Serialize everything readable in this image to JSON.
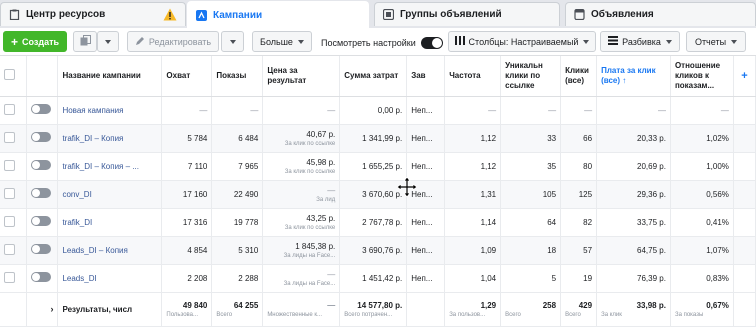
{
  "tabs": [
    {
      "label": "Центр ресурсов",
      "icon": "clipboard-icon"
    },
    {
      "label": "Кампании",
      "icon": "campaign-icon"
    },
    {
      "label": "Группы объявлений",
      "icon": "grid-icon"
    },
    {
      "label": "Объявления",
      "icon": "page-icon"
    }
  ],
  "toolbar": {
    "create_label": "Создать",
    "edit_label": "Редактировать",
    "more_label": "Больше",
    "view_settings_label": "Посмотреть настройки",
    "columns_label": "Столбцы: Настраиваемый",
    "breakdown_label": "Разбивка",
    "reports_label": "Отчеты"
  },
  "columns": {
    "name": "Название кампании",
    "reach": "Охват",
    "impressions": "Показы",
    "cost_per_result": "Цена за результат",
    "amount_spent": "Сумма затрат",
    "end": "Зав",
    "frequency": "Частота",
    "unique_link_clicks": "Уникальн клики по ссылке",
    "clicks_all": "Клики (все)",
    "cpc_all": "Плата за клик (все)",
    "ctr": "Отношение кликов к показам..."
  },
  "rows": [
    {
      "name": "Новая кампания",
      "reach": "—",
      "impressions": "—",
      "cpr": "—",
      "cpr_sub": "",
      "spent": "0,00 р.",
      "end": "Неп...",
      "freq": "—",
      "ulc": "—",
      "clicks": "—",
      "cpc": "—",
      "ctr": "—"
    },
    {
      "name": "trafik_DI – Копия",
      "reach": "5 784",
      "impressions": "6 484",
      "cpr": "40,67 р.",
      "cpr_sub": "За клик по ссылке",
      "spent": "1 341,99 р.",
      "end": "Неп...",
      "freq": "1,12",
      "ulc": "33",
      "clicks": "66",
      "cpc": "20,33 р.",
      "ctr": "1,02%"
    },
    {
      "name": "trafik_DI – Копия – ...",
      "reach": "7 110",
      "impressions": "7 965",
      "cpr": "45,98 р.",
      "cpr_sub": "За клик по ссылке",
      "spent": "1 655,25 р.",
      "end": "Неп...",
      "freq": "1,12",
      "ulc": "35",
      "clicks": "80",
      "cpc": "20,69 р.",
      "ctr": "1,00%"
    },
    {
      "name": "conv_DI",
      "reach": "17 160",
      "impressions": "22 490",
      "cpr": "—",
      "cpr_sub": "За лид",
      "spent": "3 670,60 р.",
      "end": "Неп...",
      "freq": "1,31",
      "ulc": "105",
      "clicks": "125",
      "cpc": "29,36 р.",
      "ctr": "0,56%"
    },
    {
      "name": "trafik_DI",
      "reach": "17 316",
      "impressions": "19 778",
      "cpr": "43,25 р.",
      "cpr_sub": "За клик по ссылке",
      "spent": "2 767,78 р.",
      "end": "Неп...",
      "freq": "1,14",
      "ulc": "64",
      "clicks": "82",
      "cpc": "33,75 р.",
      "ctr": "0,41%"
    },
    {
      "name": "Leads_DI – Копия",
      "reach": "4 854",
      "impressions": "5 310",
      "cpr": "1 845,38 р.",
      "cpr_sub": "За лиды на Face...",
      "spent": "3 690,76 р.",
      "end": "Неп...",
      "freq": "1,09",
      "ulc": "18",
      "clicks": "57",
      "cpc": "64,75 р.",
      "ctr": "1,07%"
    },
    {
      "name": "Leads_DI",
      "reach": "2 208",
      "impressions": "2 288",
      "cpr": "—",
      "cpr_sub": "За лиды на Face...",
      "spent": "1 451,42 р.",
      "end": "Неп...",
      "freq": "1,04",
      "ulc": "5",
      "clicks": "19",
      "cpc": "76,39 р.",
      "ctr": "0,83%"
    }
  ],
  "total": {
    "label": "Результаты, числ",
    "reach": "49 840",
    "reach_sub": "Пользова...",
    "impressions": "64 255",
    "impressions_sub": "Всего",
    "cpr": "—",
    "cpr_sub": "Множественные к...",
    "spent": "14 577,80 р.",
    "spent_sub": "Всего потрачен...",
    "freq": "1,29",
    "freq_sub": "За пользов...",
    "ulc": "258",
    "ulc_sub": "Всего",
    "clicks": "429",
    "clicks_sub": "Всего",
    "cpc": "33,98 р.",
    "cpc_sub": "За клик",
    "ctr": "0,67%",
    "ctr_sub": "За показы"
  },
  "colors": {
    "accent": "#1877f2",
    "create": "#42b72a",
    "warning": "#f7b928"
  }
}
